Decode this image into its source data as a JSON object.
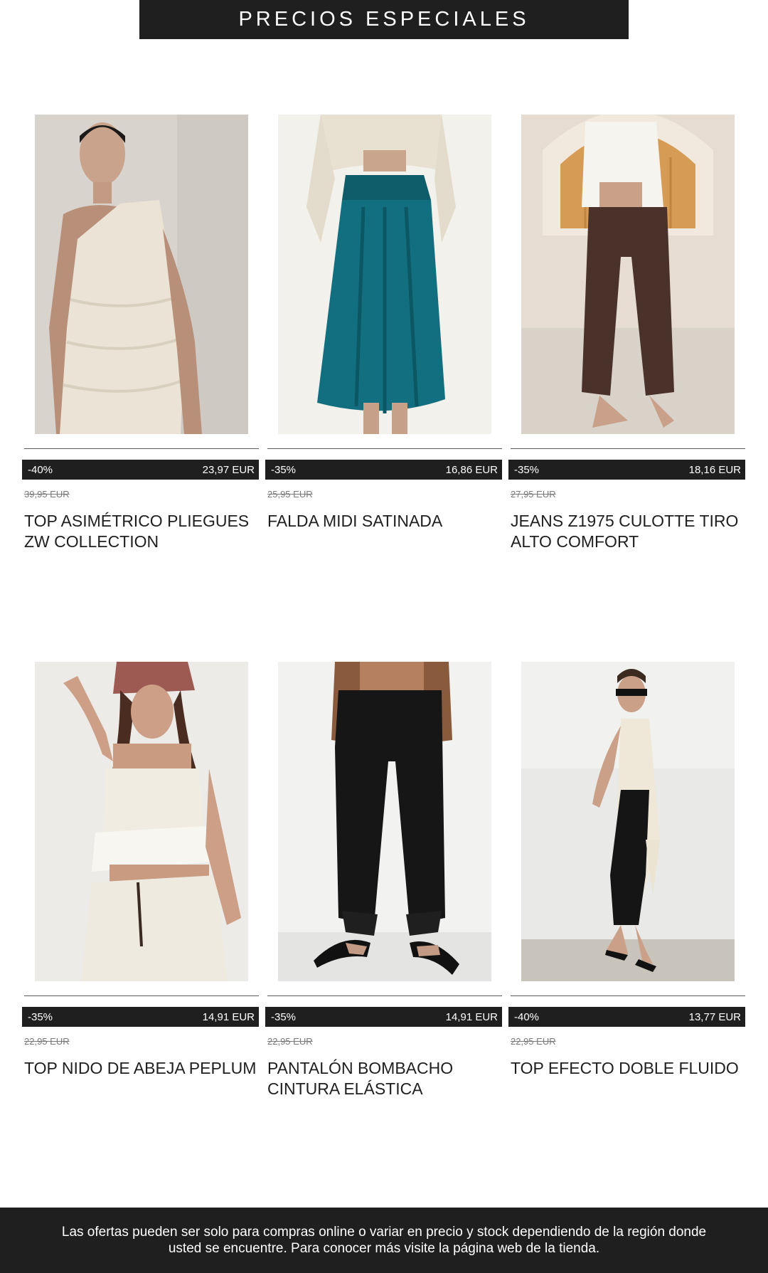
{
  "banner": {
    "title": "PRECIOS ESPECIALES"
  },
  "products": [
    {
      "image": "photo-white-ruffled-slip-top",
      "discount": "-40%",
      "price": "23,97 EUR",
      "original_price": "39,95 EUR",
      "title": "TOP ASIMÉTRICO PLIEGUES ZW COLLECTION"
    },
    {
      "image": "photo-teal-satin-midi-skirt",
      "discount": "-35%",
      "price": "16,86 EUR",
      "original_price": "25,95 EUR",
      "title": "FALDA MIDI SATINADA"
    },
    {
      "image": "photo-brown-culotte-jeans",
      "discount": "-35%",
      "price": "18,16 EUR",
      "original_price": "27,95 EUR",
      "title": "JEANS Z1975 CULOTTE TIRO ALTO COMFORT"
    },
    {
      "image": "photo-white-smocked-peplum-top",
      "discount": "-35%",
      "price": "14,91 EUR",
      "original_price": "22,95 EUR",
      "title": "TOP NIDO DE ABEJA PEPLUM"
    },
    {
      "image": "photo-black-harem-trousers",
      "discount": "-35%",
      "price": "14,91 EUR",
      "original_price": "22,95 EUR",
      "title": "PANTALÓN BOMBACHO CINTURA ELÁSTICA"
    },
    {
      "image": "photo-cream-double-layer-top",
      "discount": "-40%",
      "price": "13,77 EUR",
      "original_price": "22,95 EUR",
      "title": "TOP EFECTO DOBLE FLUIDO"
    }
  ],
  "footer": {
    "disclaimer": "Las ofertas pueden ser solo para compras online o variar en precio y stock dependiendo de la región donde usted se encuentre. Para conocer más visite la página web de la tienda."
  },
  "colors": {
    "dark": "#1f1f1f",
    "text_on_dark": "#ffffff",
    "muted": "#7a7a7a"
  }
}
